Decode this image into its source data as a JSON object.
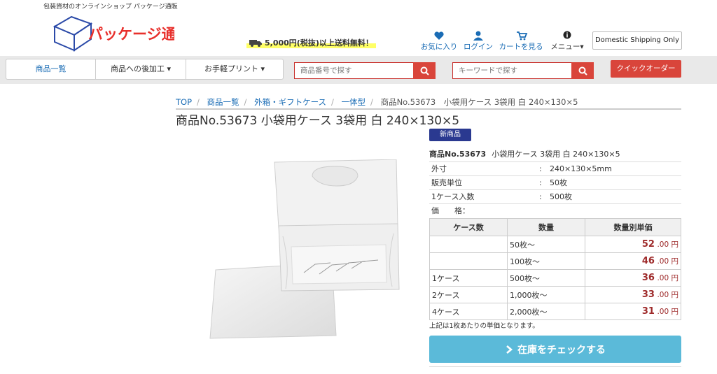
{
  "header": {
    "tagline": "包装資材のオンラインショップ パッケージ通販",
    "logo_text": "パッケージ通販",
    "shipping": "5,000円(税抜)以上送料無料！",
    "favorites": "お気に入り",
    "login": "ログイン",
    "cart": "カートを見る",
    "menu": "メニュー▾",
    "domestic": "Domestic Shipping Only"
  },
  "nav": {
    "items": [
      "商品一覧",
      "商品への後加工 ▾",
      "お手軽プリント ▾"
    ],
    "search_number_placeholder": "商品番号で探す",
    "search_keyword_placeholder": "キーワードで探す",
    "quick_order": "クイックオーダー"
  },
  "breadcrumb": [
    "TOP",
    "商品一覧",
    "外箱・ギフトケース",
    "一体型",
    "商品No.53673　小袋用ケース 3袋用 白 240×130×5"
  ],
  "product": {
    "title": "商品No.53673 小袋用ケース 3袋用 白 240×130×5",
    "badge": "新商品",
    "number": "商品No.53673",
    "name": "小袋用ケース 3袋用 白 240×130×5",
    "specs": [
      {
        "key": "外寸",
        "val": "240×130×5mm"
      },
      {
        "key": "販売単位",
        "val": "50枚"
      },
      {
        "key": "1ケース入数",
        "val": "500枚"
      }
    ],
    "price_label": "価　　格：",
    "colon": ":"
  },
  "price_table": {
    "headers": [
      "ケース数",
      "数量",
      "数量別単価"
    ],
    "rows": [
      {
        "cases": "",
        "qty": "50枚～",
        "price": "52",
        "unit": ".00 円"
      },
      {
        "cases": "",
        "qty": "100枚～",
        "price": "46",
        "unit": ".00 円"
      },
      {
        "cases": "1ケース",
        "qty": "500枚～",
        "price": "36",
        "unit": ".00 円"
      },
      {
        "cases": "2ケース",
        "qty": "1,000枚～",
        "price": "33",
        "unit": ".00 円"
      },
      {
        "cases": "4ケース",
        "qty": "2,000枚～",
        "price": "31",
        "unit": ".00 円"
      }
    ]
  },
  "note": "上記は1枚あたりの単価となります。",
  "stock_button": "在庫をチェックする",
  "colors": {
    "accent_red": "#d9453b",
    "price_red": "#9e2a2a",
    "badge_navy": "#2a3990",
    "stock_blue": "#5bbad9",
    "link_blue": "#1a6cb5"
  }
}
